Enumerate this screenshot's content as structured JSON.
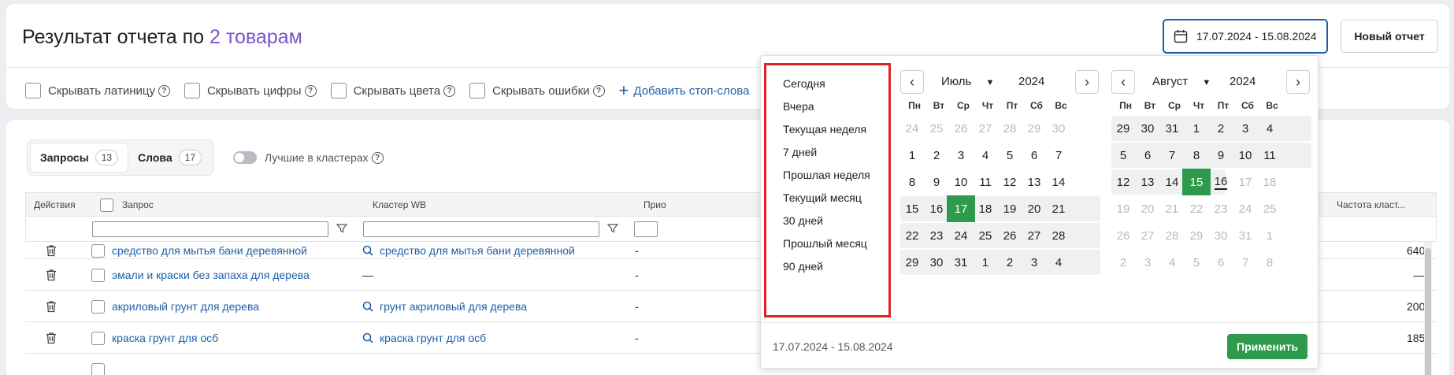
{
  "header": {
    "title_prefix": "Результат отчета по",
    "title_accent": "2 товарам",
    "date_range": "17.07.2024 - 15.08.2024",
    "new_report": "Новый отчет"
  },
  "filters": {
    "hide_latin": "Скрывать латиницу",
    "hide_digits": "Скрывать цифры",
    "hide_colors": "Скрывать цвета",
    "hide_errors": "Скрывать ошибки",
    "add_stop_words": "Добавить стоп-слова",
    "help_glyph": "?"
  },
  "tabs": [
    {
      "label": "Запросы",
      "count": "13"
    },
    {
      "label": "Слова",
      "count": "17"
    }
  ],
  "best_in_clusters": "Лучшие в кластерах",
  "table": {
    "headers": {
      "actions": "Действия",
      "query": "Запрос",
      "cluster": "Кластер WB",
      "partial": "Прио",
      "freq": "Частота класт..."
    },
    "rows": [
      {
        "query": "средство для мытья бани деревянной",
        "cluster": "средство для мытья бани деревянной",
        "col3": "-",
        "freq": "640"
      },
      {
        "query": "эмали и краски без запаха для дерева",
        "cluster": "—",
        "col3": "-",
        "freq": "—"
      },
      {
        "query": "акриловый грунт для дерева",
        "cluster": "грунт акриловый для дерева",
        "col3": "-",
        "freq": "200"
      },
      {
        "query": "краска грунт для осб",
        "cluster": "краска грунт для осб",
        "col3": "-",
        "freq": "185"
      }
    ]
  },
  "datepicker": {
    "presets": [
      "Сегодня",
      "Вчера",
      "Текущая неделя",
      "7 дней",
      "Прошлая неделя",
      "Текущий месяц",
      "30 дней",
      "Прошлый месяц",
      "90 дней"
    ],
    "weekdays": [
      "Пн",
      "Вт",
      "Ср",
      "Чт",
      "Пт",
      "Сб",
      "Вс"
    ],
    "left": {
      "month": "Июль",
      "year": "2024",
      "days": [
        [
          "24",
          "25",
          "26",
          "27",
          "28",
          "29",
          "30"
        ],
        [
          "1",
          "2",
          "3",
          "4",
          "5",
          "6",
          "7"
        ],
        [
          "8",
          "9",
          "10",
          "11",
          "12",
          "13",
          "14"
        ],
        [
          "15",
          "16",
          "17",
          "18",
          "19",
          "20",
          "21"
        ],
        [
          "22",
          "23",
          "24",
          "25",
          "26",
          "27",
          "28"
        ],
        [
          "29",
          "30",
          "31",
          "1",
          "2",
          "3",
          "4"
        ]
      ]
    },
    "right": {
      "month": "Август",
      "year": "2024",
      "days": [
        [
          "29",
          "30",
          "31",
          "1",
          "2",
          "3",
          "4"
        ],
        [
          "5",
          "6",
          "7",
          "8",
          "9",
          "10",
          "11"
        ],
        [
          "12",
          "13",
          "14",
          "15",
          "16",
          "17",
          "18"
        ],
        [
          "19",
          "20",
          "21",
          "22",
          "23",
          "24",
          "25"
        ],
        [
          "26",
          "27",
          "28",
          "29",
          "30",
          "31",
          "1"
        ],
        [
          "2",
          "3",
          "4",
          "5",
          "6",
          "7",
          "8"
        ]
      ]
    },
    "footer_range": "17.07.2024 - 15.08.2024",
    "apply": "Применить"
  },
  "colors": {
    "accent": "#7a55c7",
    "link": "#1e5fa8",
    "selected": "#2e9a4b",
    "highlight_border": "#e02424"
  }
}
